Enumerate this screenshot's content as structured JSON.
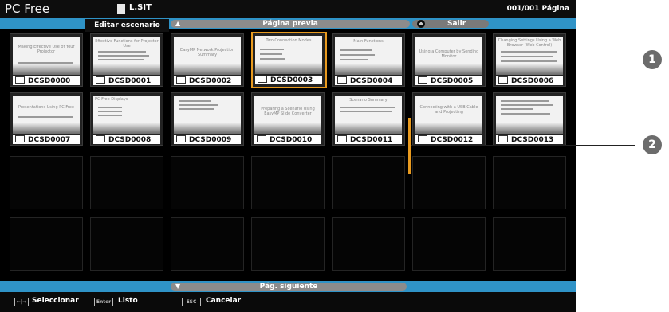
{
  "app_title": "PC Free",
  "file_name": "L.SIT",
  "page_count": "001/001 Página",
  "tabs": {
    "edit_label": "Editar escenario"
  },
  "nav": {
    "prev_label": "Página previa",
    "prev_arrow": "▲",
    "next_label": "Pág. siguiente",
    "next_arrow": "▼"
  },
  "exit": {
    "label": "Salir",
    "icon": "exit-icon"
  },
  "thumbnails": [
    {
      "label": "DCSD0000",
      "caption": "Making Effective Use of Your Projector"
    },
    {
      "label": "DCSD0001",
      "caption": "Effective Functions for Projector Use"
    },
    {
      "label": "DCSD0002",
      "caption": "EasyMP Network Projection Summary"
    },
    {
      "label": "DCSD0003",
      "caption": "Two Connection Modes"
    },
    {
      "label": "DCSD0004",
      "caption": "Main Functions"
    },
    {
      "label": "DCSD0005",
      "caption": "Using a Computer by Sending Monitor"
    },
    {
      "label": "DCSD0006",
      "caption": "Changing Settings Using a Web Browser (Web Control)"
    },
    {
      "label": "DCSD0007",
      "caption": "Presentations Using PC Free"
    },
    {
      "label": "DCSD0008",
      "caption": "PC Free Displays"
    },
    {
      "label": "DCSD0009",
      "caption": ""
    },
    {
      "label": "DCSD0010",
      "caption": "Preparing a Scenario Using EasyMP Slide Converter"
    },
    {
      "label": "DCSD0011",
      "caption": "Scenario Summary"
    },
    {
      "label": "DCSD0012",
      "caption": "Connecting with a USB Cable and Projecting"
    },
    {
      "label": "DCSD0013",
      "caption": ""
    }
  ],
  "help": {
    "select_key": "←|→",
    "select_label": "Seleccionar",
    "enter_key": "Enter",
    "enter_label": "Listo",
    "esc_key": "ESC",
    "esc_label": "Cancelar"
  },
  "callouts": [
    "1",
    "2"
  ],
  "colors": {
    "accent_blue": "#2f93c7",
    "selection_orange": "#e89a1f"
  }
}
